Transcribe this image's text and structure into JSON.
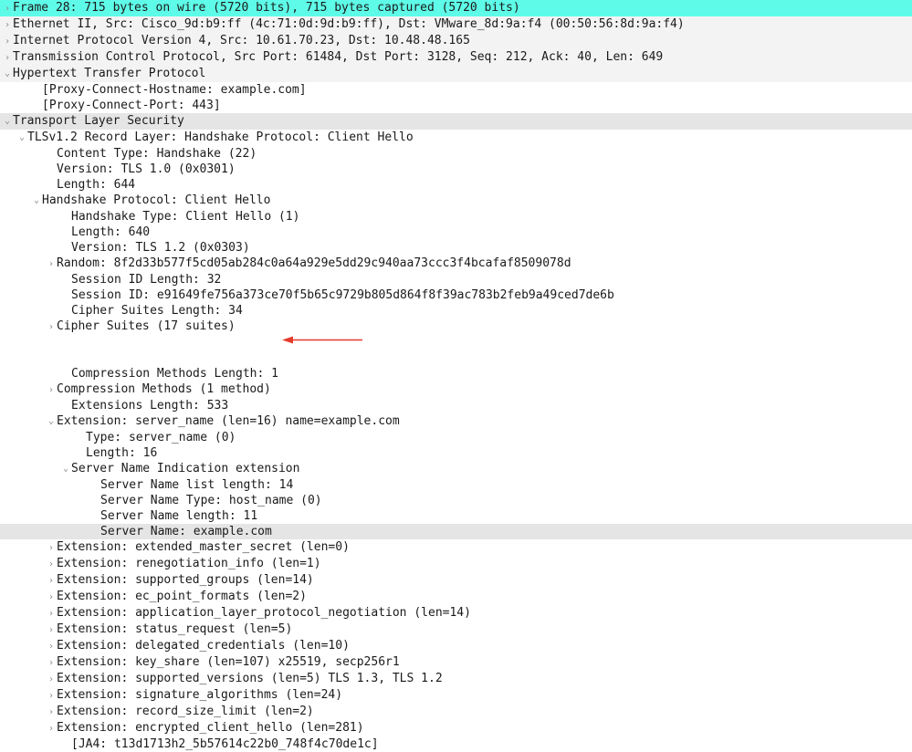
{
  "frame": {
    "summary": "Frame 28: 715 bytes on wire (5720 bits), 715 bytes captured (5720 bits)"
  },
  "eth": {
    "summary": "Ethernet II, Src: Cisco_9d:b9:ff (4c:71:0d:9d:b9:ff), Dst: VMware_8d:9a:f4 (00:50:56:8d:9a:f4)"
  },
  "ip": {
    "summary": "Internet Protocol Version 4, Src: 10.61.70.23, Dst: 10.48.48.165"
  },
  "tcp": {
    "summary": "Transmission Control Protocol, Src Port: 61484, Dst Port: 3128, Seq: 212, Ack: 40, Len: 649"
  },
  "http": {
    "summary": "Hypertext Transfer Protocol",
    "proxy_host": "[Proxy-Connect-Hostname: example.com]",
    "proxy_port": "[Proxy-Connect-Port: 443]"
  },
  "tls": {
    "summary": "Transport Layer Security",
    "record": {
      "summary": "TLSv1.2 Record Layer: Handshake Protocol: Client Hello",
      "content_type": "Content Type: Handshake (22)",
      "version": "Version: TLS 1.0 (0x0301)",
      "length": "Length: 644",
      "handshake": {
        "summary": "Handshake Protocol: Client Hello",
        "type": "Handshake Type: Client Hello (1)",
        "length": "Length: 640",
        "version": "Version: TLS 1.2 (0x0303)",
        "random": "Random: 8f2d33b577f5cd05ab284c0a64a929e5dd29c940aa73ccc3f4bcafaf8509078d",
        "sid_len": "Session ID Length: 32",
        "sid": "Session ID: e91649fe756a373ce70f5b65c9729b805d864f8f39ac783b2feb9a49ced7de6b",
        "cs_len": "Cipher Suites Length: 34",
        "cs": "Cipher Suites (17 suites)",
        "cm_len": "Compression Methods Length: 1",
        "cm": "Compression Methods (1 method)",
        "ext_len": "Extensions Length: 533",
        "ext_sni": {
          "summary": "Extension: server_name (len=16) name=example.com",
          "type": "Type: server_name (0)",
          "length": "Length: 16",
          "sni": {
            "summary": "Server Name Indication extension",
            "list_len": "Server Name list length: 14",
            "name_type": "Server Name Type: host_name (0)",
            "name_len": "Server Name length: 11",
            "name": "Server Name: example.com"
          }
        },
        "ext_list": [
          "Extension: extended_master_secret (len=0)",
          "Extension: renegotiation_info (len=1)",
          "Extension: supported_groups (len=14)",
          "Extension: ec_point_formats (len=2)",
          "Extension: application_layer_protocol_negotiation (len=14)",
          "Extension: status_request (len=5)",
          "Extension: delegated_credentials (len=10)",
          "Extension: key_share (len=107) x25519, secp256r1",
          "Extension: supported_versions (len=5) TLS 1.3, TLS 1.2",
          "Extension: signature_algorithms (len=24)",
          "Extension: record_size_limit (len=2)",
          "Extension: encrypted_client_hello (len=281)"
        ],
        "ja4": "[JA4: t13d1713h2_5b57614c22b0_748f4c70de1c]"
      }
    }
  },
  "glyphs": {
    "closed": "›",
    "open": "⌄"
  }
}
